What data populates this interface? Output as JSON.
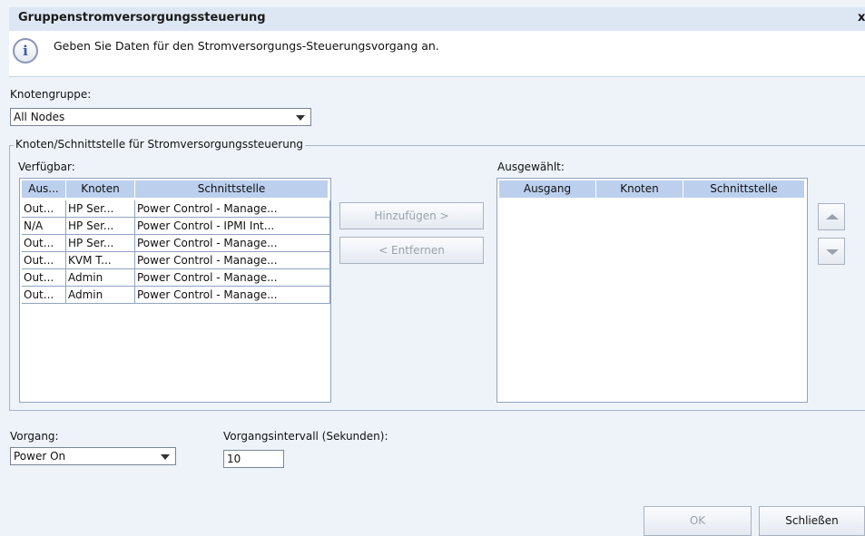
{
  "dialog": {
    "title": "Gruppenstromversorgungssteuerung",
    "close_glyph": "x",
    "info_text": "Geben Sie Daten für den Stromversorgungs-Steuerungsvorgang an."
  },
  "node_group": {
    "label": "Knotengruppe:",
    "value": "All Nodes"
  },
  "group_box": {
    "legend": "Knoten/Schnittstelle für Stromversorgungssteuerung",
    "available_label": "Verfügbar:",
    "selected_label": "Ausgewählt:"
  },
  "available_table": {
    "columns": [
      "Aus...",
      "Knoten",
      "Schnittstelle"
    ],
    "rows": [
      [
        "Out...",
        "HP Ser...",
        "Power Control - Manage..."
      ],
      [
        "N/A",
        "HP Ser...",
        "Power Control - IPMI Int..."
      ],
      [
        "Out...",
        "HP Ser...",
        "Power Control - Manage..."
      ],
      [
        "Out...",
        "KVM T...",
        "Power Control - Manage..."
      ],
      [
        "Out...",
        "Admin",
        "Power Control - Manage..."
      ],
      [
        "Out...",
        "Admin",
        "Power Control - Manage..."
      ]
    ]
  },
  "selected_table": {
    "columns": [
      "Ausgang",
      "Knoten",
      "Schnittstelle"
    ],
    "rows": []
  },
  "transfer": {
    "add_label": "Hinzufügen  >",
    "remove_label": "<  Entfernen"
  },
  "operation": {
    "label": "Vorgang:",
    "value": "Power On"
  },
  "interval": {
    "label": "Vorgangsintervall (Sekunden):",
    "value": "10"
  },
  "footer": {
    "ok_label": "OK",
    "close_label": "Schließen"
  },
  "icons": {
    "info": "info-icon",
    "move_up": "arrow-up-icon",
    "move_down": "arrow-down-icon",
    "dropdown": "chevron-down-icon"
  }
}
